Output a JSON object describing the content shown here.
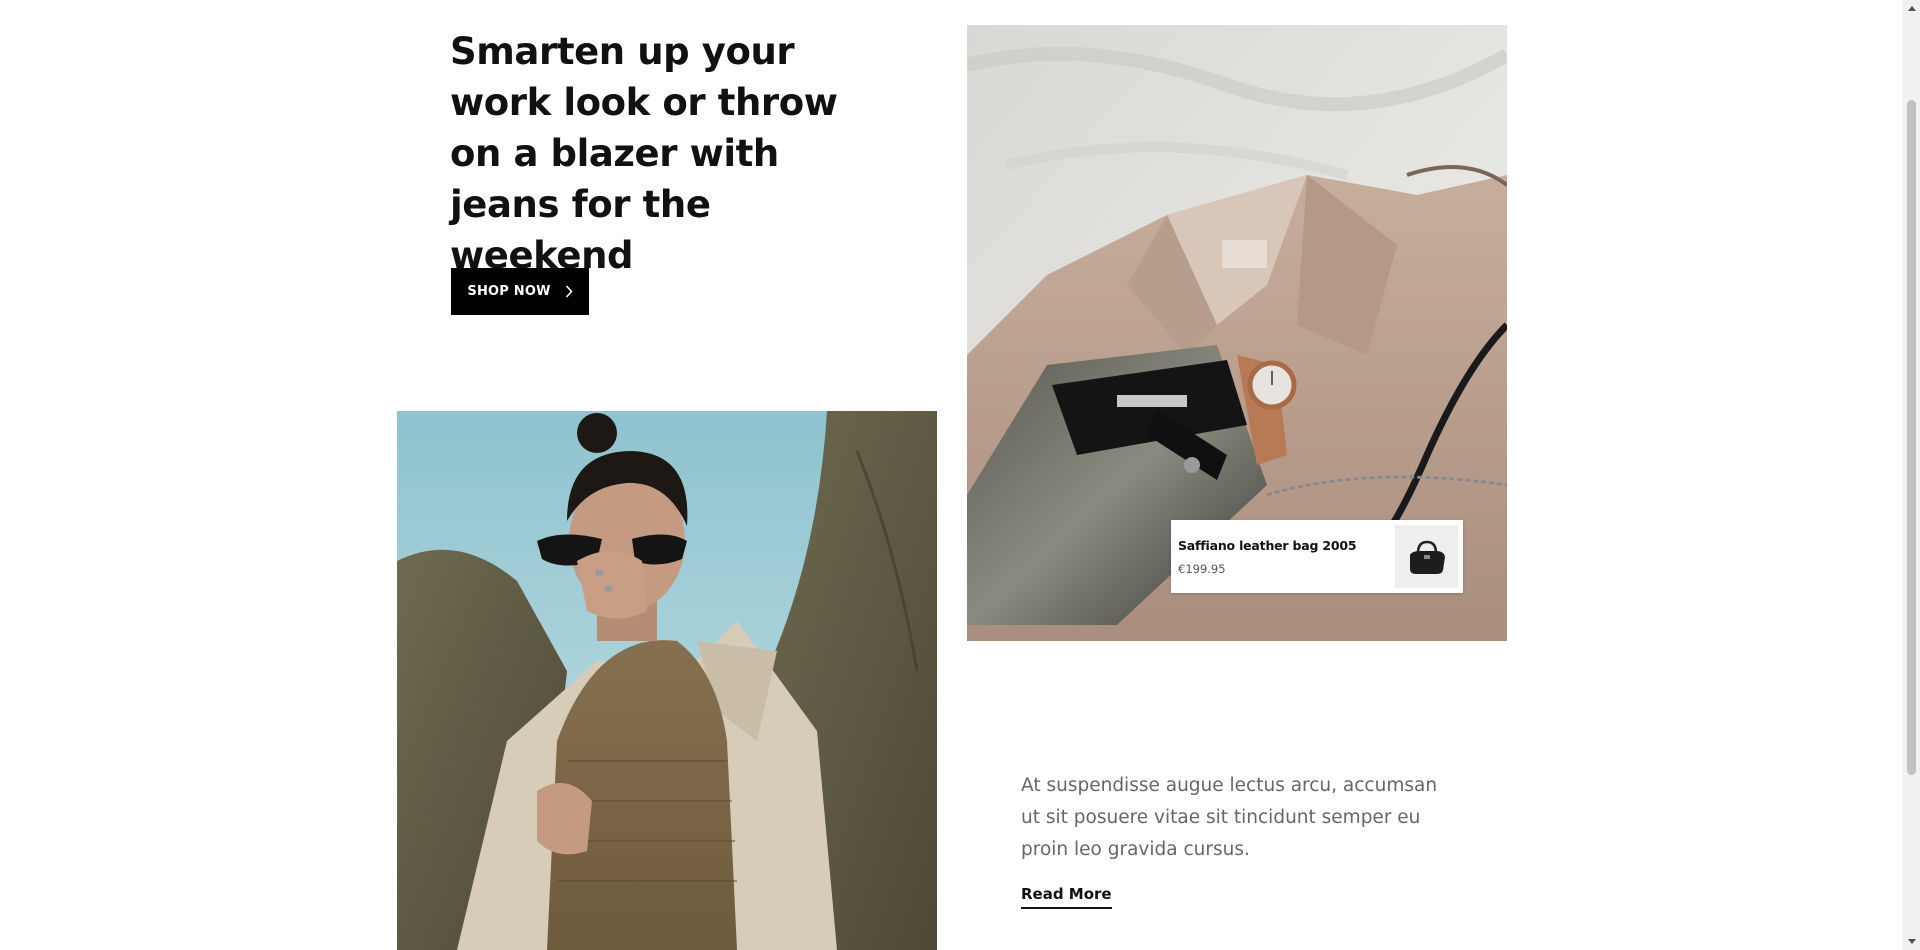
{
  "hero": {
    "headline": "Smarten up your work look or throw on a blazer with jeans for the weekend",
    "cta_label": "SHOP NOW",
    "cta_icon": "chevron-right-icon"
  },
  "product_card": {
    "name": "Saffiano leather bag 2005",
    "price": "€199.95",
    "thumb_icon": "handbag-thumbnail"
  },
  "article": {
    "body": "At suspendisse augue lectus arcu, accumsan ut sit posuere vitae sit tincidunt semper eu proin leo gravida cursus.",
    "link_label": "Read More"
  },
  "scrollbar": {
    "position": 0.14
  },
  "colors": {
    "button_bg": "#000000",
    "button_text": "#ffffff",
    "body_text": "#666666",
    "heading_text": "#111111",
    "coat_beige": "#b89f8f",
    "sky_blue": "#9fcfd8"
  }
}
